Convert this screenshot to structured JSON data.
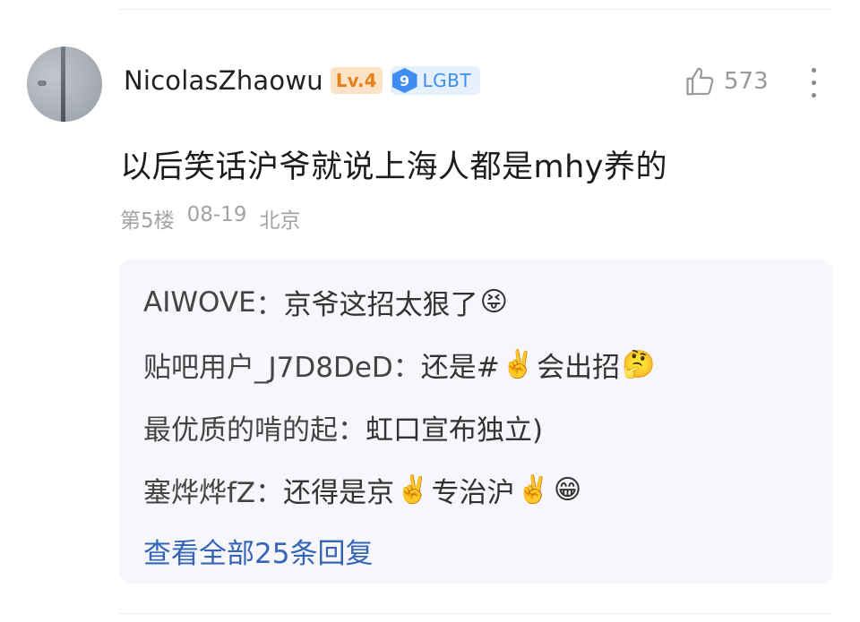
{
  "comment": {
    "username": "NicolasZhaowu",
    "level_badge": "Lv.4",
    "tag_number": "9",
    "tag_label": "LGBT",
    "like_count": "573",
    "text": "以后笑话沪爷就说上海人都是mhy养的",
    "floor": "第5楼",
    "date": "08-19",
    "location": "北京"
  },
  "replies": [
    {
      "name": "AIWOVE",
      "sep": "：",
      "text": "京爷这招太狠了",
      "emoji_after": "😝"
    },
    {
      "name": "贴吧用户_J7D8DeD",
      "sep": "：",
      "text_a": "还是#",
      "emoji_mid": "✌️",
      "text_b": "会出招",
      "emoji_after": "🤔"
    },
    {
      "name": "最优质的啃的起",
      "sep": "：",
      "text": "虹口宣布独立)"
    },
    {
      "name": "塞烨烨fZ",
      "sep": "：",
      "text_a": "还得是京",
      "emoji_mid": "✌️",
      "text_b": "专治沪",
      "emoji_mid2": "✌️",
      "emoji_after": "😁"
    }
  ],
  "view_all": "查看全部25条回复",
  "icons": [
    "avatar",
    "thumbs-up-icon",
    "more-vertical-icon"
  ]
}
